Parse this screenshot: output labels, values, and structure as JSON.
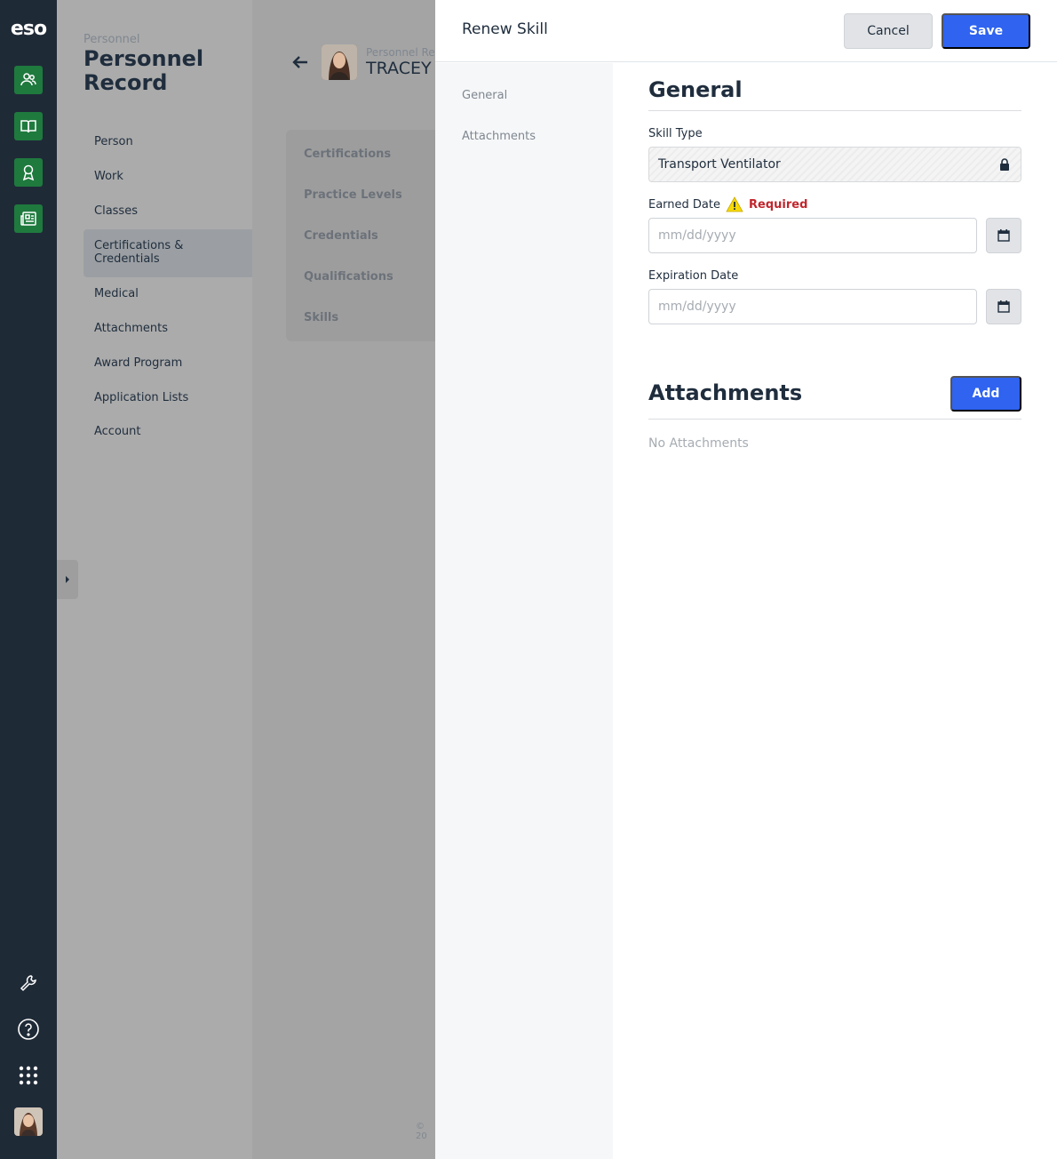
{
  "brand": {
    "logo_text": "eso"
  },
  "left_nav": {
    "crumb": "Personnel",
    "title": "Personnel Record",
    "items": [
      {
        "label": "Person"
      },
      {
        "label": "Work"
      },
      {
        "label": "Classes"
      },
      {
        "label": "Certifications & Credentials",
        "selected": true
      },
      {
        "label": "Medical"
      },
      {
        "label": "Attachments"
      },
      {
        "label": "Award Program"
      },
      {
        "label": "Application Lists"
      },
      {
        "label": "Account"
      }
    ]
  },
  "main": {
    "person_subtitle": "Personnel Re",
    "person_name": "TRACEY",
    "card_items": [
      {
        "label": "Certifications"
      },
      {
        "label": "Practice Levels"
      },
      {
        "label": "Credentials"
      },
      {
        "label": "Qualifications"
      },
      {
        "label": "Skills"
      }
    ],
    "copyright": "© 20"
  },
  "drawer": {
    "title": "Renew Skill",
    "cancel_label": "Cancel",
    "save_label": "Save",
    "side_links": [
      {
        "label": "General"
      },
      {
        "label": "Attachments"
      }
    ],
    "general": {
      "heading": "General",
      "skill_type_label": "Skill Type",
      "skill_type_value": "Transport Ventilator",
      "earned_date_label": "Earned Date",
      "required_text": "Required",
      "earned_date_placeholder": "mm/dd/yyyy",
      "expiration_date_label": "Expiration Date",
      "expiration_date_placeholder": "mm/dd/yyyy"
    },
    "attachments": {
      "heading": "Attachments",
      "add_label": "Add",
      "empty_text": "No Attachments"
    }
  },
  "colors": {
    "accent": "#2f63f0",
    "rail": "#1f2a37",
    "rail_button": "#1f7a3e",
    "required": "#c0262d"
  },
  "icons": {
    "rail_top": [
      "people-icon",
      "book-icon",
      "award-icon",
      "newspaper-icon"
    ],
    "rail_bottom": [
      "wrench-icon",
      "help-icon",
      "apps-grid-icon"
    ],
    "other": [
      "back-arrow-icon",
      "lock-icon",
      "warning-icon",
      "calendar-icon",
      "chevron-right-icon"
    ]
  }
}
